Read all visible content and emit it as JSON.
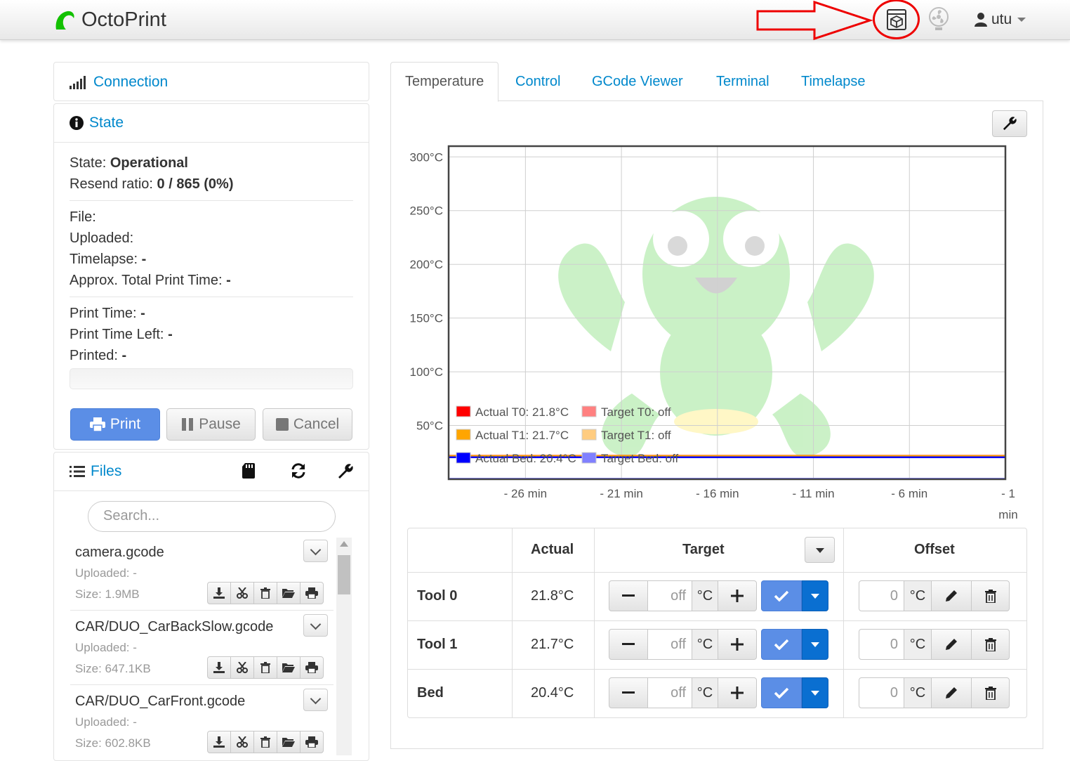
{
  "app": {
    "name": "OctoPrint",
    "user": "utu"
  },
  "sidebar": {
    "connection": {
      "title": "Connection"
    },
    "state": {
      "title": "State",
      "state_label": "State:",
      "state_value": "Operational",
      "resend_label": "Resend ratio:",
      "resend_value": "0 / 865 (0%)",
      "file_label": "File:",
      "uploaded_label": "Uploaded:",
      "timelapse_label": "Timelapse:",
      "timelapse_value": "-",
      "approx_label": "Approx. Total Print Time:",
      "approx_value": "-",
      "printtime_label": "Print Time:",
      "printtime_value": "-",
      "timeleft_label": "Print Time Left:",
      "timeleft_value": "-",
      "printed_label": "Printed:",
      "printed_value": "-",
      "progress": 0,
      "buttons": {
        "print": "Print",
        "pause": "Pause",
        "cancel": "Cancel"
      }
    },
    "files": {
      "title": "Files",
      "search_placeholder": "Search...",
      "items": [
        {
          "name": "camera.gcode",
          "uploaded": "Uploaded: -",
          "size": "Size: 1.9MB"
        },
        {
          "name": "CAR/DUO_CarBackSlow.gcode",
          "uploaded": "Uploaded: -",
          "size": "Size: 647.1KB"
        },
        {
          "name": "CAR/DUO_CarFront.gcode",
          "uploaded": "Uploaded: -",
          "size": "Size: 602.8KB"
        }
      ]
    }
  },
  "tabs": [
    "Temperature",
    "Control",
    "GCode Viewer",
    "Terminal",
    "Timelapse"
  ],
  "chart_data": {
    "type": "line",
    "y_ticks": [
      "300°C",
      "250°C",
      "200°C",
      "150°C",
      "100°C",
      "50°C"
    ],
    "x_ticks": [
      "- 26 min",
      "- 21 min",
      "- 16 min",
      "- 11 min",
      "- 6 min",
      "- 1"
    ],
    "x_tick_extra": "min",
    "ylim": [
      0,
      310
    ],
    "xlim": [
      -30,
      -1
    ],
    "legend": [
      {
        "label": "Actual T0: 21.8°C",
        "color": "#ff0000"
      },
      {
        "label": "Target T0: off",
        "color": "#ff8080"
      },
      {
        "label": "Actual T1: 21.7°C",
        "color": "#ffa500"
      },
      {
        "label": "Target T1: off",
        "color": "#ffcc80"
      },
      {
        "label": "Actual Bed: 20.4°C",
        "color": "#0000ff"
      },
      {
        "label": "Target Bed: off",
        "color": "#8080ff"
      }
    ],
    "series": [
      {
        "name": "Actual T0",
        "color": "#ff0000",
        "values": [
          21.8,
          21.8
        ]
      },
      {
        "name": "Actual T1",
        "color": "#ffa500",
        "values": [
          21.7,
          21.7
        ]
      },
      {
        "name": "Actual Bed",
        "color": "#0000ff",
        "values": [
          20.4,
          20.4
        ]
      }
    ],
    "grid": true,
    "legend_position": "bottom-left"
  },
  "temperature": {
    "headers": {
      "actual": "Actual",
      "target": "Target",
      "offset": "Offset"
    },
    "rows": [
      {
        "name": "Tool 0",
        "actual": "21.8°C",
        "target": "off",
        "offset": "0"
      },
      {
        "name": "Tool 1",
        "actual": "21.7°C",
        "target": "off",
        "offset": "0"
      },
      {
        "name": "Bed",
        "actual": "20.4°C",
        "target": "off",
        "offset": "0"
      }
    ],
    "unit": "°C"
  }
}
